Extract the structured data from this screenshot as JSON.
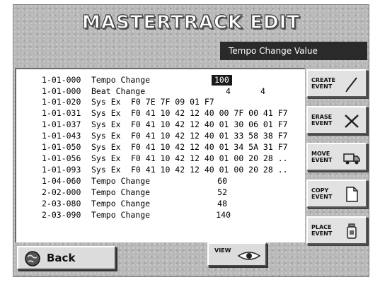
{
  "title": "MASTERTRACK EDIT",
  "parameter_label": "Tempo Change Value",
  "events": [
    {
      "time": "1-01-000",
      "type": "Tempo Change",
      "value": "100",
      "selected": true
    },
    {
      "time": "1-01-000",
      "type": "Beat Change",
      "value": "4",
      "value2": "4"
    },
    {
      "time": "1-01-020",
      "type": "Sys Ex",
      "data": "F0 7E 7F 09 01 F7"
    },
    {
      "time": "1-01-031",
      "type": "Sys Ex",
      "data": "F0 41 10 42 12 40 00 7F 00 41 F7"
    },
    {
      "time": "1-01-037",
      "type": "Sys Ex",
      "data": "F0 41 10 42 12 40 01 30 06 01 F7"
    },
    {
      "time": "1-01-043",
      "type": "Sys Ex",
      "data": "F0 41 10 42 12 40 01 33 58 38 F7"
    },
    {
      "time": "1-01-050",
      "type": "Sys Ex",
      "data": "F0 41 10 42 12 40 01 34 5A 31 F7"
    },
    {
      "time": "1-01-056",
      "type": "Sys Ex",
      "data": "F0 41 10 42 12 40 01 00 20 28 .."
    },
    {
      "time": "1-01-093",
      "type": "Sys Ex",
      "data": "F0 41 10 42 12 40 01 00 20 28 .."
    },
    {
      "time": "1-04-060",
      "type": "Tempo Change",
      "value": "60"
    },
    {
      "time": "2-02-000",
      "type": "Tempo Change",
      "value": "52"
    },
    {
      "time": "2-03-080",
      "type": "Tempo Change",
      "value": "48"
    },
    {
      "time": "2-03-090",
      "type": "Tempo Change",
      "value": "140"
    }
  ],
  "buttons": {
    "create": {
      "line1": "CREATE",
      "line2": "EVENT",
      "icon": "pencil-icon"
    },
    "erase": {
      "line1": "ERASE",
      "line2": "EVENT",
      "icon": "x-icon"
    },
    "move": {
      "line1": "MOVE",
      "line2": "EVENT",
      "icon": "truck-icon"
    },
    "copy": {
      "line1": "COPY",
      "line2": "EVENT",
      "icon": "document-icon"
    },
    "place": {
      "line1": "PLACE",
      "line2": "EVENT",
      "icon": "jar-icon"
    },
    "back": {
      "label": "Back",
      "icon": "globe-icon"
    },
    "view": {
      "label": "VIEW",
      "icon": "eye-icon"
    }
  }
}
